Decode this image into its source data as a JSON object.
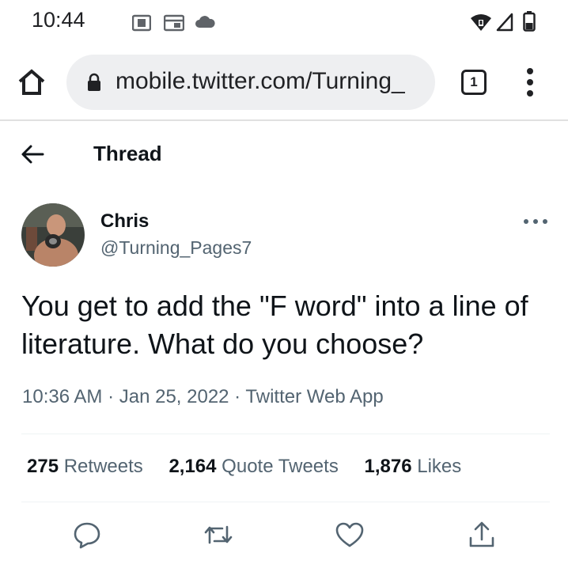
{
  "status_bar": {
    "time": "10:44",
    "icons": [
      "photos-icon",
      "calendar-icon",
      "cloud-icon",
      "wifi-icon",
      "signal-icon",
      "battery-icon"
    ]
  },
  "browser": {
    "url": "mobile.twitter.com/Turning_",
    "tab_count": "1"
  },
  "header": {
    "title": "Thread"
  },
  "tweet": {
    "author_name": "Chris",
    "author_handle": "@Turning_Pages7",
    "text": "You get to add the \"F word\" into a line of literature. What do you choose?",
    "meta": "10:36 AM · Jan 25, 2022 · Twitter Web App"
  },
  "stats": {
    "retweets_count": "275",
    "retweets_label": "Retweets",
    "quotes_count": "2,164",
    "quotes_label": "Quote Tweets",
    "likes_count": "1,876",
    "likes_label": "Likes"
  },
  "actions": [
    "reply-icon",
    "retweet-icon",
    "like-icon",
    "share-icon"
  ],
  "colors": {
    "text_primary": "#0f1419",
    "text_secondary": "#536471",
    "url_bar_bg": "#eeeff1"
  }
}
